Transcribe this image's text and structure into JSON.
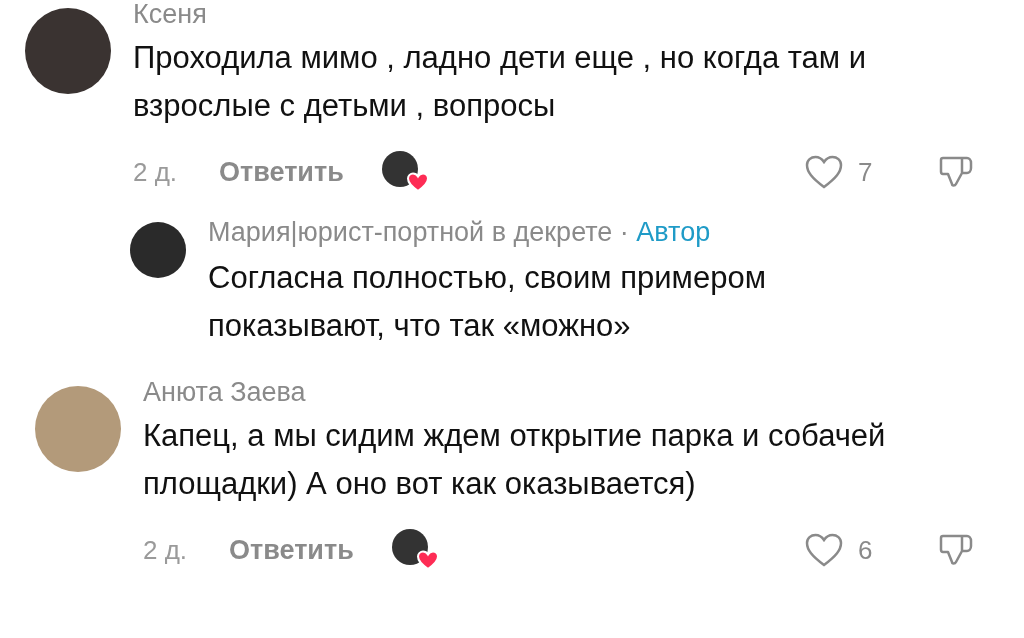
{
  "comments": [
    {
      "author": "Ксеня",
      "text": "Проходила мимо , ладно дети еще , но когда там и взрослые с детьми , вопросы",
      "time": "2 д.",
      "reply_label": "Ответить",
      "author_liked": true,
      "liked": false,
      "likes": "7",
      "replies": [
        {
          "author": "Мария|юрист-портной в декрете",
          "separator": "·",
          "badge": "Автор",
          "text": "Согласна полностью, своим примером показывают, что так «можно»"
        }
      ]
    },
    {
      "author": "Анюта Заева",
      "text": "Капец, а мы сидим ждем открытие парка и собачей площадки) А оно вот как оказывается)",
      "time": "2 д.",
      "reply_label": "Ответить",
      "author_liked": true,
      "liked": false,
      "likes": "6"
    }
  ]
}
